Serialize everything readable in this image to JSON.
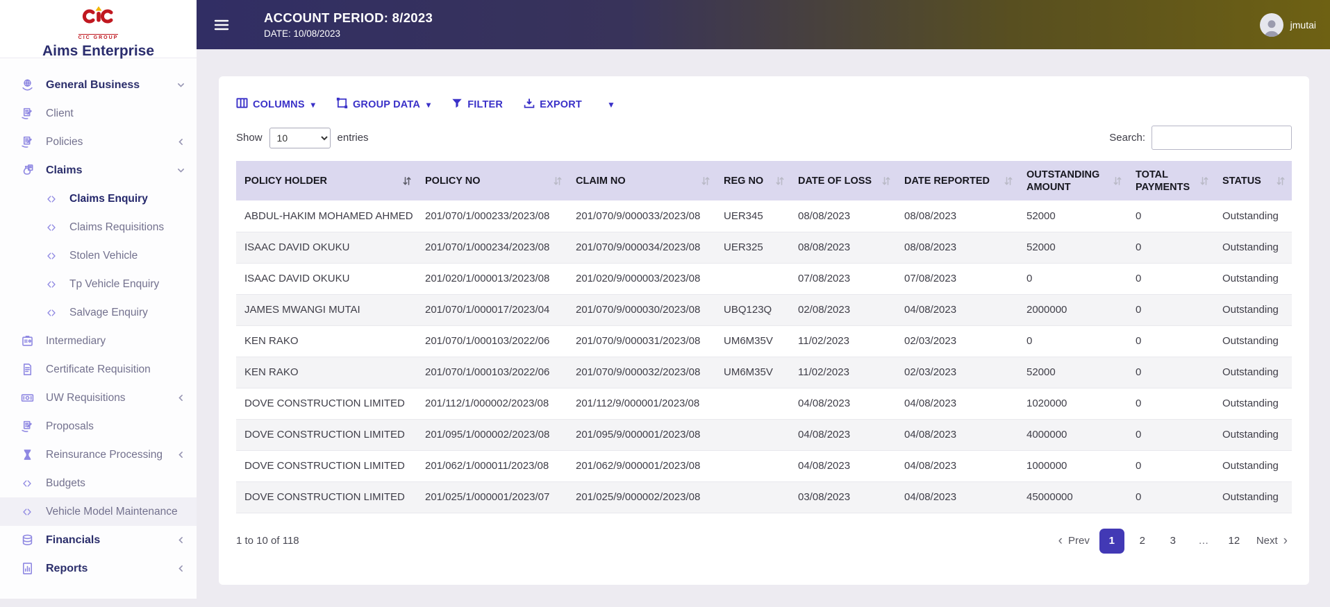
{
  "brand": {
    "logo_text": "CIC GROUP",
    "app_name": "Aims Enterprise"
  },
  "topbar": {
    "title": "ACCOUNT PERIOD: 8/2023",
    "subtitle": "DATE: 10/08/2023",
    "username": "jmutai"
  },
  "sidebar": {
    "items": [
      {
        "label": "General Business",
        "icon": "globe-hand-icon",
        "style": "section",
        "chevron": "down"
      },
      {
        "label": "Client",
        "icon": "document-pen-icon",
        "style": "item",
        "chevron": null
      },
      {
        "label": "Policies",
        "icon": "document-pen-icon",
        "style": "item",
        "chevron": "left"
      },
      {
        "label": "Claims",
        "icon": "money-bag-icon",
        "style": "section",
        "chevron": "down"
      },
      {
        "label": "Claims Enquiry",
        "icon": "double-chevron-icon",
        "style": "sub active",
        "chevron": null
      },
      {
        "label": "Claims Requisitions",
        "icon": "double-chevron-icon",
        "style": "sub",
        "chevron": null
      },
      {
        "label": "Stolen Vehicle",
        "icon": "double-chevron-icon",
        "style": "sub",
        "chevron": null
      },
      {
        "label": "Tp Vehicle Enquiry",
        "icon": "double-chevron-icon",
        "style": "sub",
        "chevron": null
      },
      {
        "label": "Salvage Enquiry",
        "icon": "double-chevron-icon",
        "style": "sub",
        "chevron": null
      },
      {
        "label": "Intermediary",
        "icon": "badge-icon",
        "style": "item",
        "chevron": null
      },
      {
        "label": "Certificate Requisition",
        "icon": "file-icon",
        "style": "item",
        "chevron": null
      },
      {
        "label": "UW Requisitions",
        "icon": "banknote-icon",
        "style": "item",
        "chevron": "left"
      },
      {
        "label": "Proposals",
        "icon": "document-pen-icon",
        "style": "item",
        "chevron": null
      },
      {
        "label": "Reinsurance Processing",
        "icon": "hourglass-icon",
        "style": "item",
        "chevron": "left"
      },
      {
        "label": "Budgets",
        "icon": "double-chevron-icon",
        "style": "item",
        "chevron": null
      },
      {
        "label": "Vehicle Model Maintenance",
        "icon": "double-chevron-icon",
        "style": "item hovered",
        "chevron": null
      },
      {
        "label": "Financials",
        "icon": "coins-icon",
        "style": "section",
        "chevron": "left"
      },
      {
        "label": "Reports",
        "icon": "report-icon",
        "style": "section",
        "chevron": "left"
      }
    ]
  },
  "toolbar": {
    "columns_label": "COLUMNS",
    "group_data_label": "GROUP DATA",
    "filter_label": "FILTER",
    "export_label": "EXPORT"
  },
  "table_controls": {
    "show_label": "Show",
    "entries_label": "entries",
    "page_size": "10",
    "search_label": "Search:",
    "search_value": ""
  },
  "table": {
    "columns": [
      {
        "label": "POLICY HOLDER",
        "sort": "active"
      },
      {
        "label": "POLICY NO",
        "sort": "default"
      },
      {
        "label": "CLAIM NO",
        "sort": "default"
      },
      {
        "label": "REG NO",
        "sort": "default"
      },
      {
        "label": "DATE OF LOSS",
        "sort": "default"
      },
      {
        "label": "DATE REPORTED",
        "sort": "default"
      },
      {
        "label": "OUTSTANDING AMOUNT",
        "sort": "default"
      },
      {
        "label": "TOTAL PAYMENTS",
        "sort": "default"
      },
      {
        "label": "STATUS",
        "sort": "default"
      }
    ],
    "rows": [
      [
        "ABDUL-HAKIM MOHAMED AHMED",
        "201/070/1/000233/2023/08",
        "201/070/9/000033/2023/08",
        "UER345",
        "08/08/2023",
        "08/08/2023",
        "52000",
        "0",
        "Outstanding"
      ],
      [
        "ISAAC DAVID OKUKU",
        "201/070/1/000234/2023/08",
        "201/070/9/000034/2023/08",
        "UER325",
        "08/08/2023",
        "08/08/2023",
        "52000",
        "0",
        "Outstanding"
      ],
      [
        "ISAAC DAVID OKUKU",
        "201/020/1/000013/2023/08",
        "201/020/9/000003/2023/08",
        "",
        "07/08/2023",
        "07/08/2023",
        "0",
        "0",
        "Outstanding"
      ],
      [
        "JAMES MWANGI MUTAI",
        "201/070/1/000017/2023/04",
        "201/070/9/000030/2023/08",
        "UBQ123Q",
        "02/08/2023",
        "04/08/2023",
        "2000000",
        "0",
        "Outstanding"
      ],
      [
        "KEN RAKO",
        "201/070/1/000103/2022/06",
        "201/070/9/000031/2023/08",
        "UM6M35V",
        "11/02/2023",
        "02/03/2023",
        "0",
        "0",
        "Outstanding"
      ],
      [
        "KEN RAKO",
        "201/070/1/000103/2022/06",
        "201/070/9/000032/2023/08",
        "UM6M35V",
        "11/02/2023",
        "02/03/2023",
        "52000",
        "0",
        "Outstanding"
      ],
      [
        "DOVE CONSTRUCTION LIMITED",
        "201/112/1/000002/2023/08",
        "201/112/9/000001/2023/08",
        "",
        "04/08/2023",
        "04/08/2023",
        "1020000",
        "0",
        "Outstanding"
      ],
      [
        "DOVE CONSTRUCTION LIMITED",
        "201/095/1/000002/2023/08",
        "201/095/9/000001/2023/08",
        "",
        "04/08/2023",
        "04/08/2023",
        "4000000",
        "0",
        "Outstanding"
      ],
      [
        "DOVE CONSTRUCTION LIMITED",
        "201/062/1/000011/2023/08",
        "201/062/9/000001/2023/08",
        "",
        "04/08/2023",
        "04/08/2023",
        "1000000",
        "0",
        "Outstanding"
      ],
      [
        "DOVE CONSTRUCTION LIMITED",
        "201/025/1/000001/2023/07",
        "201/025/9/000002/2023/08",
        "",
        "03/08/2023",
        "04/08/2023",
        "45000000",
        "0",
        "Outstanding"
      ]
    ]
  },
  "footer": {
    "summary": "1 to 10 of 118",
    "pagination": {
      "prev_label": "Prev",
      "next_label": "Next",
      "pages": [
        "1",
        "2",
        "3",
        "…",
        "12"
      ],
      "active_page": "1"
    }
  },
  "colors": {
    "accent": "#3a31c8",
    "topbar_left": "#312e64",
    "topbar_right": "#6e6113",
    "header_bg": "#dbd8ef",
    "active_page_bg": "#4239b5"
  }
}
